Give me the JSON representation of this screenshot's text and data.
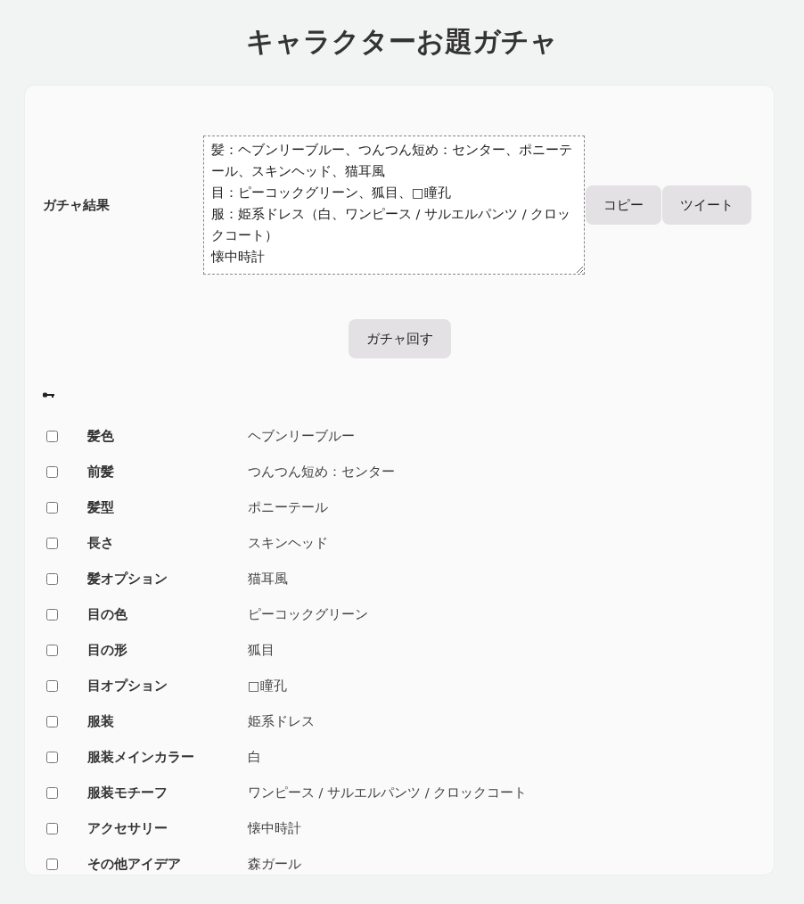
{
  "title": "キャラクターお題ガチャ",
  "result": {
    "label": "ガチャ結果",
    "lines": [
      "髪：ヘブンリーブルー、つんつん短め：センター、ポニーテール、スキンヘッド、猫耳風",
      "目：ピーコックグリーン、狐目、□瞳孔",
      "服：姫系ドレス（白、ワンピース / サルエルパンツ / クロックコート）",
      "懐中時計"
    ]
  },
  "buttons": [
    "コピー",
    "ツイート"
  ],
  "spin_button": "ガチャ回す",
  "items": [
    {
      "label": "髪色",
      "value": "ヘブンリーブルー",
      "checked": false
    },
    {
      "label": "前髪",
      "value": "つんつん短め：センター",
      "checked": false
    },
    {
      "label": "髪型",
      "value": "ポニーテール",
      "checked": false
    },
    {
      "label": "長さ",
      "value": "スキンヘッド",
      "checked": false
    },
    {
      "label": "髪オプション",
      "value": "猫耳風",
      "checked": false
    },
    {
      "label": "目の色",
      "value": "ピーコックグリーン",
      "checked": false
    },
    {
      "label": "目の形",
      "value": "狐目",
      "checked": false
    },
    {
      "label": "目オプション",
      "value": "□瞳孔",
      "checked": false
    },
    {
      "label": "服装",
      "value": "姫系ドレス",
      "checked": false
    },
    {
      "label": "服装メインカラー",
      "value": "白",
      "checked": false
    },
    {
      "label": "服装モチーフ",
      "value": "ワンピース / サルエルパンツ / クロックコート",
      "checked": false
    },
    {
      "label": "アクセサリー",
      "value": "懐中時計",
      "checked": false
    },
    {
      "label": "その他アイデア",
      "value": "森ガール",
      "checked": false
    }
  ]
}
